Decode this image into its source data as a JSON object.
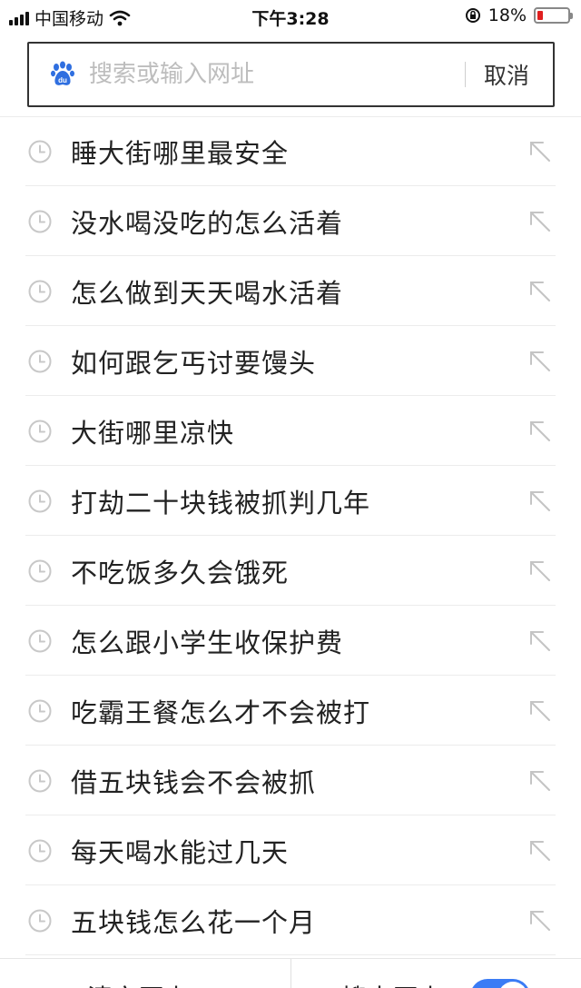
{
  "status_bar": {
    "carrier": "中国移动",
    "time": "下午3:28",
    "battery_percent": "18%",
    "battery_level": 0.18,
    "battery_color": "#e02020",
    "icons": [
      "signal-bars-icon",
      "wifi-icon",
      "orientation-lock-icon",
      "battery-icon"
    ]
  },
  "search": {
    "placeholder": "搜索或输入网址",
    "cancel_label": "取消",
    "icon": "baidu-paw-icon"
  },
  "history": {
    "item_icon": "clock-icon",
    "fill_icon": "arrow-up-left-icon",
    "items": [
      {
        "text": "睡大街哪里最安全"
      },
      {
        "text": "没水喝没吃的怎么活着"
      },
      {
        "text": "怎么做到天天喝水活着"
      },
      {
        "text": "如何跟乞丐讨要馒头"
      },
      {
        "text": "大街哪里凉快"
      },
      {
        "text": "打劫二十块钱被抓判几年"
      },
      {
        "text": "不吃饭多久会饿死"
      },
      {
        "text": "怎么跟小学生收保护费"
      },
      {
        "text": "吃霸王餐怎么才不会被打"
      },
      {
        "text": "借五块钱会不会被抓"
      },
      {
        "text": "每天喝水能过几天"
      },
      {
        "text": "五块钱怎么花一个月"
      }
    ]
  },
  "bottom": {
    "clear_label": "清空历史",
    "history_toggle_label": "搜索历史",
    "history_toggle_on": true,
    "accent_color": "#3b7cf5"
  }
}
